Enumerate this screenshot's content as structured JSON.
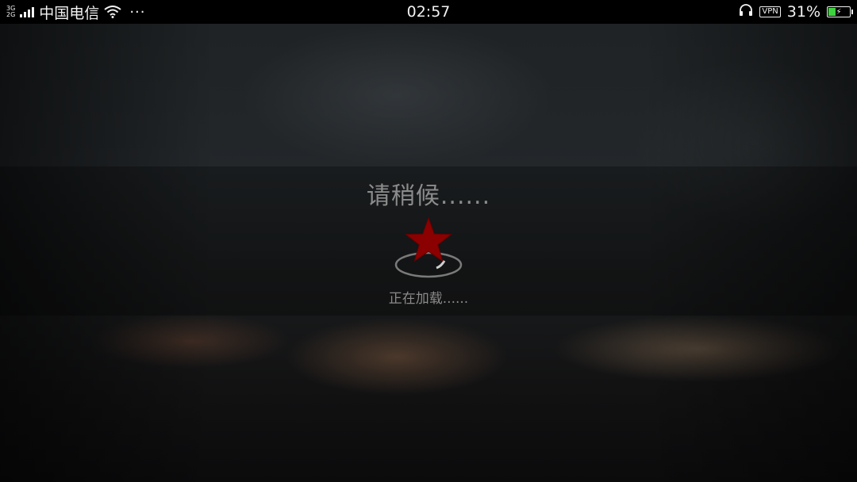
{
  "status_bar": {
    "network_types": [
      "3G",
      "2G"
    ],
    "carrier": "中国电信",
    "more": "···",
    "time": "02:57",
    "vpn": "VPN",
    "battery_percent": "31%",
    "battery_level": 0.31,
    "icons": [
      "signal-icon",
      "wifi-icon",
      "more-icon",
      "headphones-icon",
      "vpn-icon",
      "battery-charging-icon"
    ]
  },
  "loading": {
    "title": "请稍候......",
    "subtitle": "正在加载......",
    "icon": "red-star-icon",
    "star_color": "#8b0000"
  }
}
